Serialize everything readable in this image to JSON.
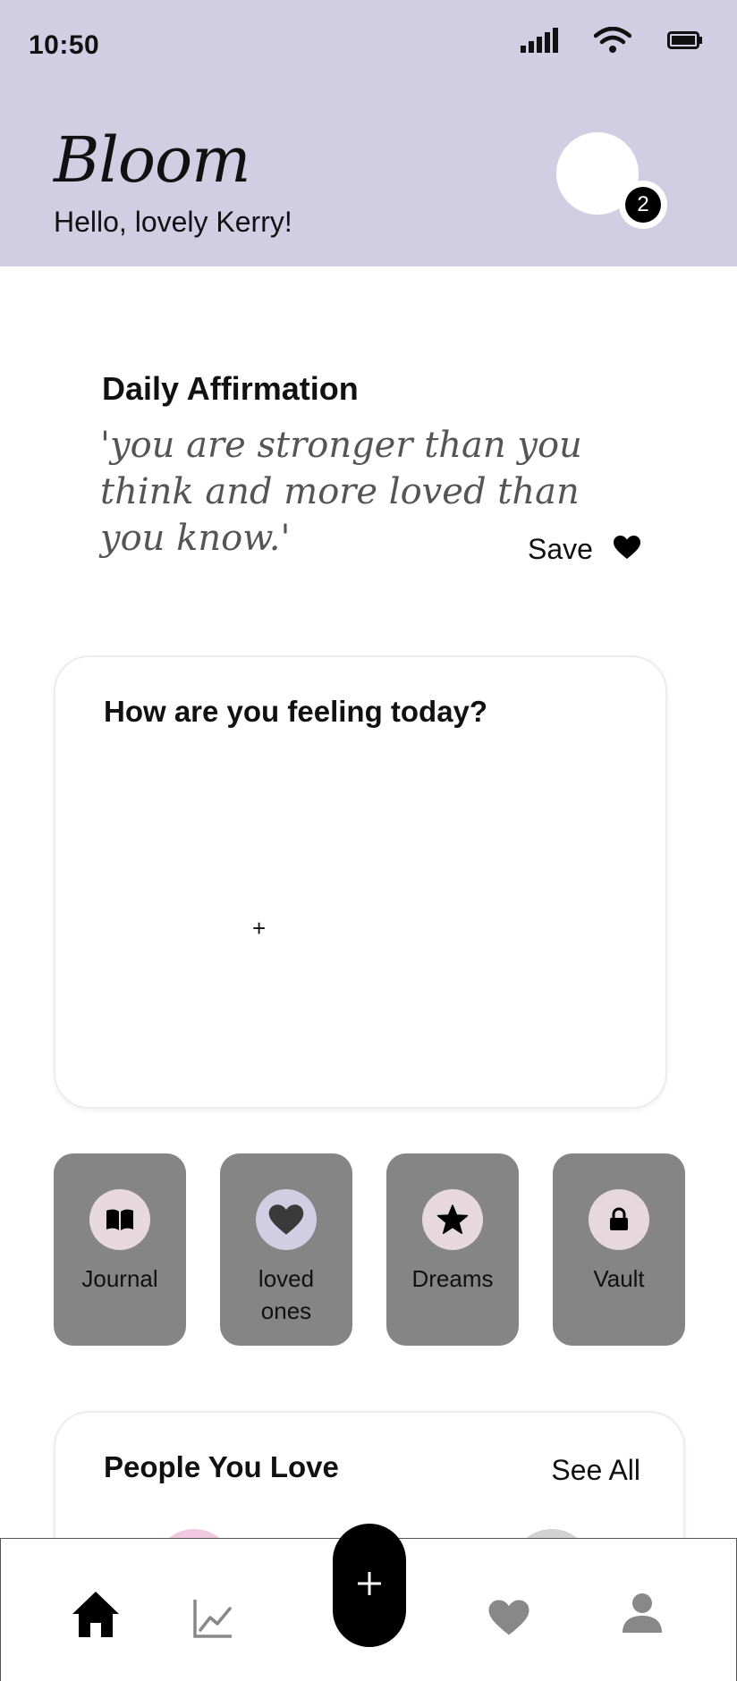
{
  "status_bar": {
    "time": "10:50",
    "icons": [
      "signal-icon",
      "wifi-icon",
      "battery-icon"
    ]
  },
  "header": {
    "brand": "Bloom",
    "greeting_prefix": "Hello, lovely ",
    "greeting_name": "Kerry!",
    "notification_count": "2",
    "background_color": "#d1cee4"
  },
  "affirmation": {
    "title": "Daily Affirmation",
    "text": "'you are stronger than you think and more loved than you know.'",
    "save_label": "Save",
    "save_icon": "heart-icon"
  },
  "feeling": {
    "title": "How are you feeling today?",
    "add_symbol": "+"
  },
  "tiles": [
    {
      "label": "Journal",
      "icon": "book-icon",
      "icon_bg": "#e6d8dc"
    },
    {
      "label": "loved ones",
      "icon": "heart-icon",
      "icon_bg": "#d1cee4"
    },
    {
      "label": "Dreams",
      "icon": "star-icon",
      "icon_bg": "#e6d8dc"
    },
    {
      "label": "Vault",
      "icon": "lock-icon",
      "icon_bg": "#e6d8dc"
    }
  ],
  "people": {
    "title": "People You Love",
    "see_all": "See All"
  },
  "bottom_nav": {
    "items": [
      "home-icon",
      "chart-icon",
      "add-icon",
      "heart-icon",
      "profile-icon"
    ],
    "fab_symbol": "+"
  }
}
